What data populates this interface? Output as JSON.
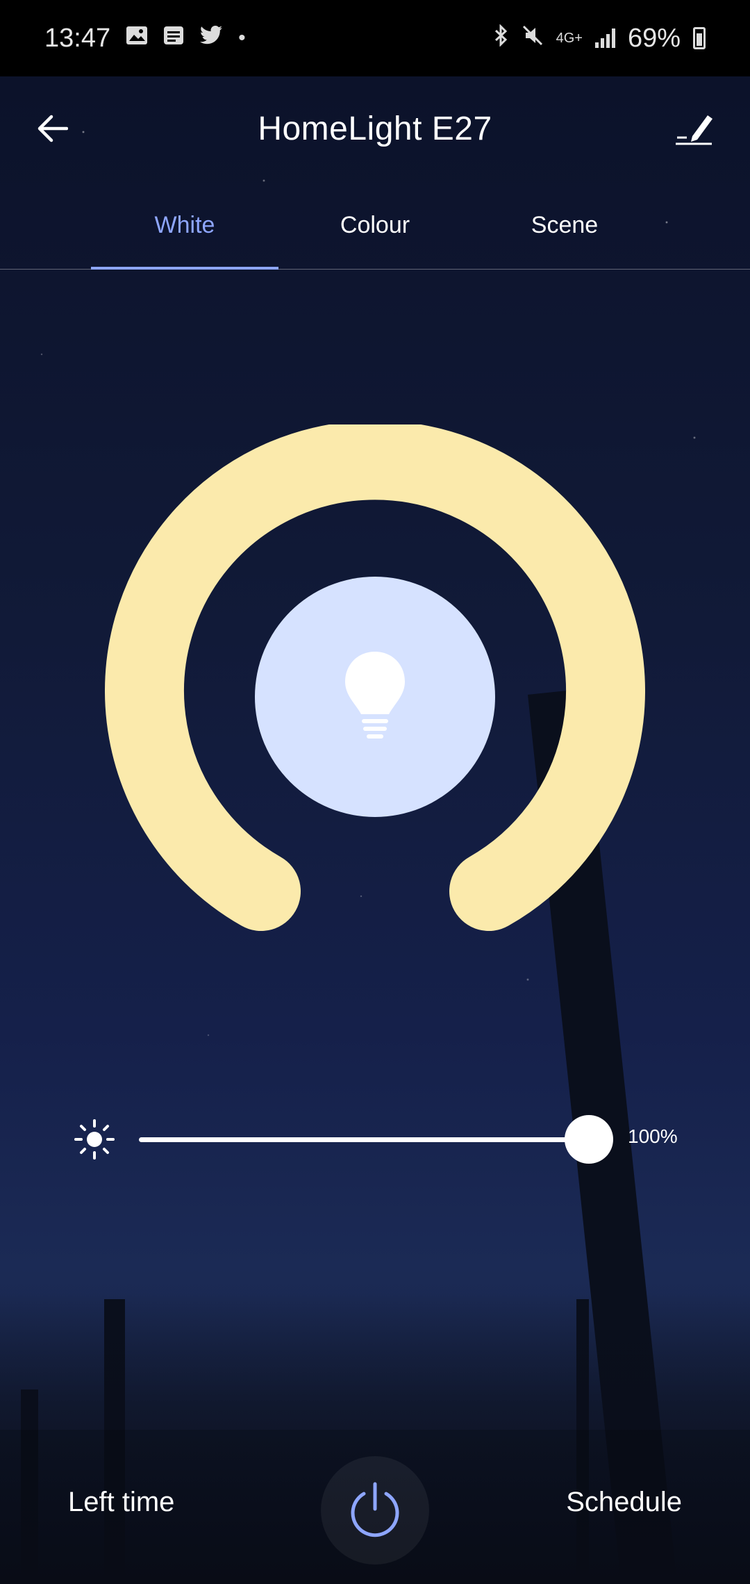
{
  "status_bar": {
    "time": "13:47",
    "network": "4G+",
    "battery": "69%"
  },
  "header": {
    "title": "HomeLight E27"
  },
  "tabs": [
    {
      "label": "White",
      "active": true
    },
    {
      "label": "Colour",
      "active": false
    },
    {
      "label": "Scene",
      "active": false
    }
  ],
  "dial": {
    "ring_color": "#fbeaac",
    "center_color": "#d6e2ff"
  },
  "brightness": {
    "value": "100%",
    "level": 1.0
  },
  "bottom_bar": {
    "left_time_label": "Left time",
    "schedule_label": "Schedule",
    "power_color": "#8ea6ff"
  },
  "colors": {
    "accent": "#8ea6ff"
  }
}
